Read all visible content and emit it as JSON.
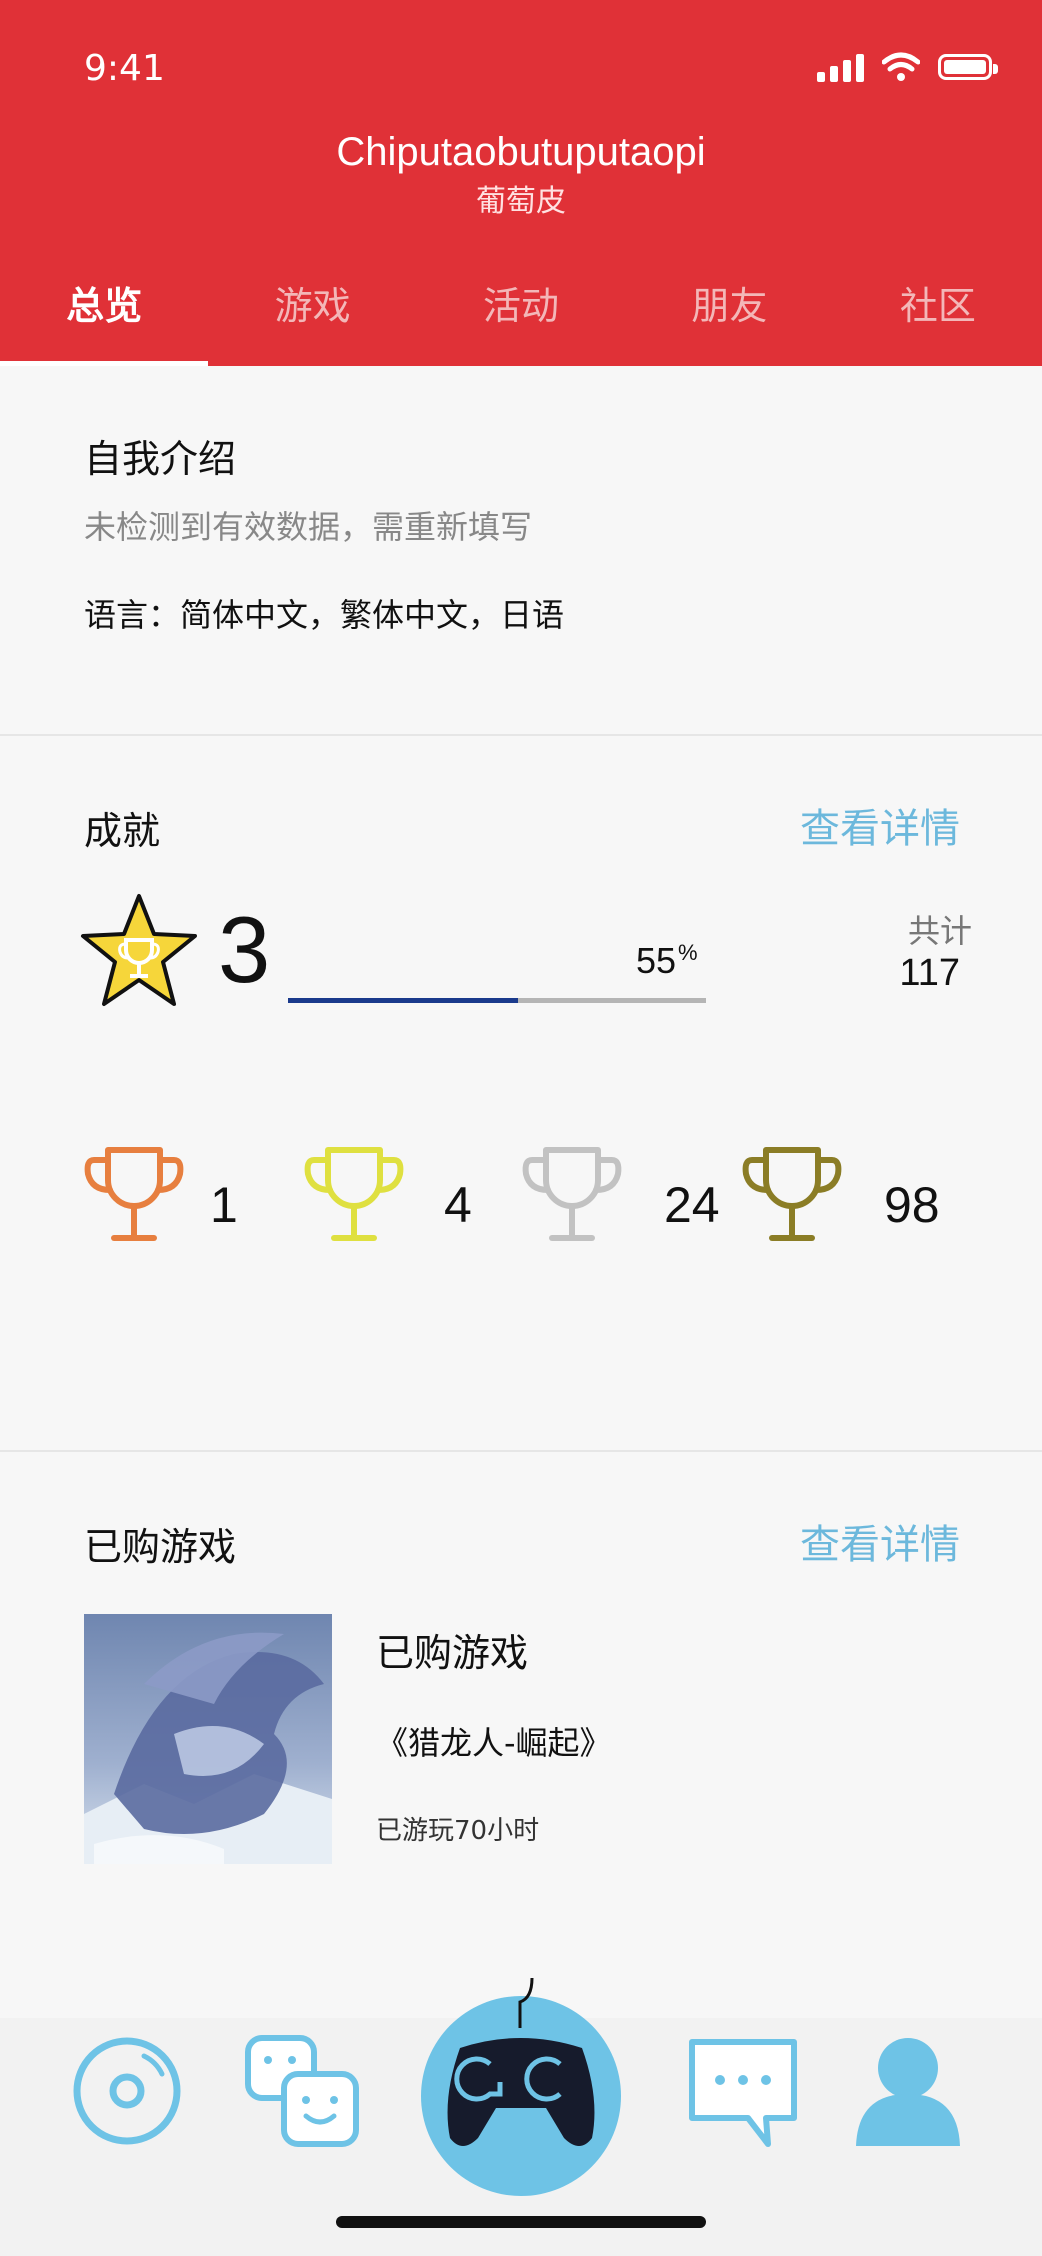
{
  "status": {
    "time": "9:41"
  },
  "header": {
    "title": "Chiputaobutuputaopi",
    "subtitle": "葡萄皮"
  },
  "tabs": [
    {
      "label": "总览",
      "active": true
    },
    {
      "label": "游戏",
      "active": false
    },
    {
      "label": "活动",
      "active": false
    },
    {
      "label": "朋友",
      "active": false
    },
    {
      "label": "社区",
      "active": false
    }
  ],
  "intro": {
    "heading": "自我介绍",
    "hint": "未检测到有效数据，需重新填写",
    "language": "语言：简体中文，繁体中文，日语"
  },
  "achievements": {
    "heading": "成就",
    "details_link": "查看详情",
    "level": "3",
    "progress_percent": "55",
    "percent_symbol": "%",
    "progress_fraction": 0.55,
    "total_label": "共计",
    "total_value": "117",
    "trophies": [
      {
        "tier": "bronze",
        "color": "#e77f3f",
        "count": "1"
      },
      {
        "tier": "gold",
        "color": "#dfe040",
        "count": "4"
      },
      {
        "tier": "silver",
        "color": "#c2c2c2",
        "count": "24"
      },
      {
        "tier": "olive",
        "color": "#8b7d26",
        "count": "98"
      }
    ]
  },
  "purchased": {
    "heading": "已购游戏",
    "details_link": "查看详情",
    "item_title": "已购游戏",
    "game_name": "《猎龙人-崛起》",
    "playtime": "已游玩70小时"
  },
  "colors": {
    "header_red": "#e03137",
    "link_blue": "#6cb8dc",
    "icon_blue": "#6ec3e6",
    "progress_blue": "#1a3a8c"
  },
  "bottom_nav": [
    "disc-icon",
    "friends-icon",
    "gamepad-icon",
    "chat-icon",
    "profile-icon"
  ]
}
